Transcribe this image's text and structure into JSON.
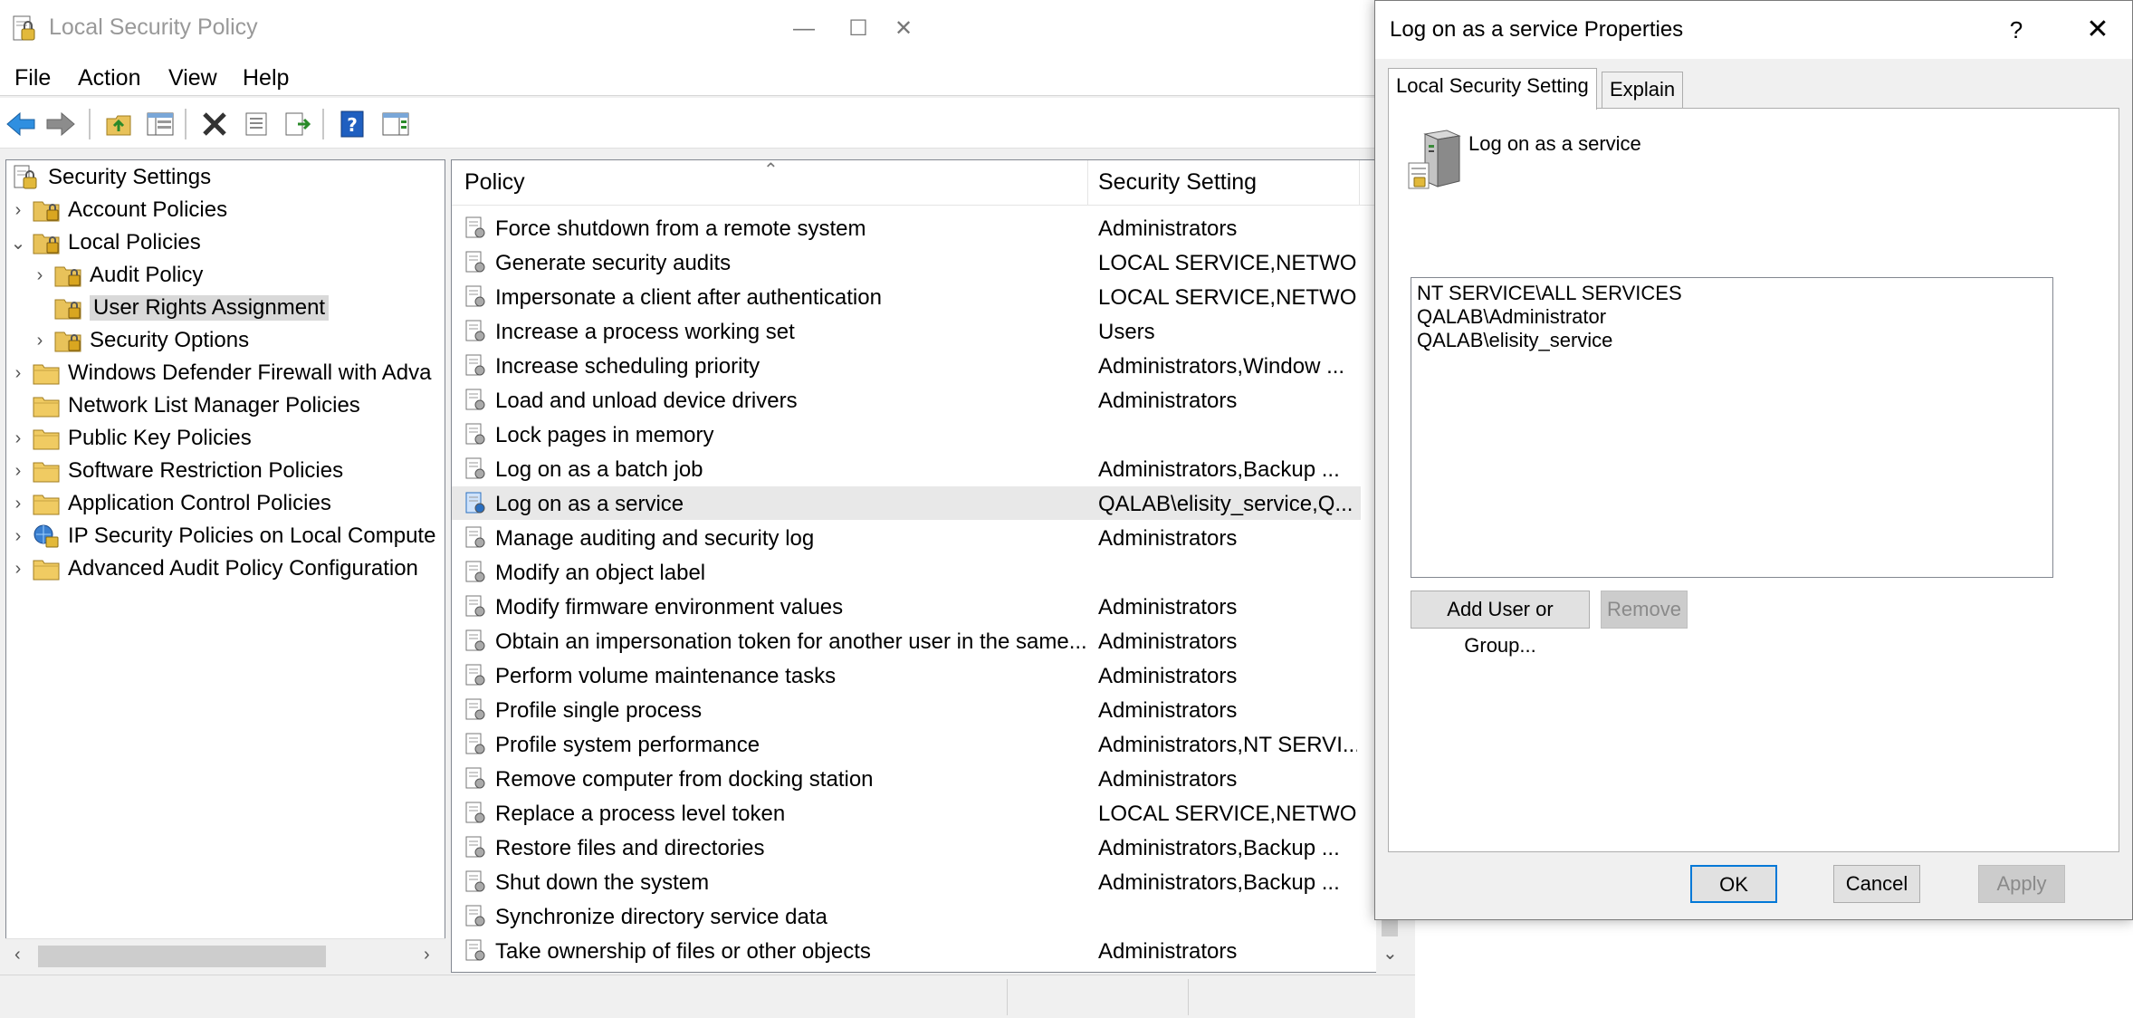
{
  "main_window": {
    "title": "Local Security Policy",
    "controls": {
      "minimize": "—",
      "maximize": "☐",
      "close": "✕"
    }
  },
  "menu": [
    "File",
    "Action",
    "View",
    "Help"
  ],
  "toolbar": {
    "icons": [
      "back-arrow-icon",
      "forward-arrow-icon",
      "up-folder-icon",
      "show-hide-tree-icon",
      "delete-icon",
      "properties-icon",
      "export-list-icon",
      "help-icon",
      "action-pane-icon"
    ]
  },
  "tree": [
    {
      "label": "Security Settings",
      "level": 0,
      "expander": "",
      "icon": "security-settings-icon"
    },
    {
      "label": "Account Policies",
      "level": 1,
      "expander": "›",
      "icon": "locked-folder-icon"
    },
    {
      "label": "Local Policies",
      "level": 1,
      "expander": "⌄",
      "icon": "locked-folder-icon"
    },
    {
      "label": "Audit Policy",
      "level": 2,
      "expander": "›",
      "icon": "locked-folder-icon"
    },
    {
      "label": "User Rights Assignment",
      "level": 2,
      "expander": "",
      "icon": "locked-folder-icon",
      "selected": true
    },
    {
      "label": "Security Options",
      "level": 2,
      "expander": "›",
      "icon": "locked-folder-icon"
    },
    {
      "label": "Windows Defender Firewall with Adva",
      "level": 1,
      "expander": "›",
      "icon": "folder-icon"
    },
    {
      "label": "Network List Manager Policies",
      "level": 1,
      "expander": "",
      "icon": "folder-icon"
    },
    {
      "label": "Public Key Policies",
      "level": 1,
      "expander": "›",
      "icon": "folder-icon"
    },
    {
      "label": "Software Restriction Policies",
      "level": 1,
      "expander": "›",
      "icon": "folder-icon"
    },
    {
      "label": "Application Control Policies",
      "level": 1,
      "expander": "›",
      "icon": "folder-icon"
    },
    {
      "label": "IP Security Policies on Local Compute",
      "level": 1,
      "expander": "›",
      "icon": "ip-security-icon"
    },
    {
      "label": "Advanced Audit Policy Configuration",
      "level": 1,
      "expander": "›",
      "icon": "folder-icon"
    }
  ],
  "list": {
    "columns": {
      "policy": "Policy",
      "setting": "Security Setting"
    },
    "rows": [
      {
        "policy": "Force shutdown from a remote system",
        "setting": "Administrators"
      },
      {
        "policy": "Generate security audits",
        "setting": "LOCAL SERVICE,NETWO..."
      },
      {
        "policy": "Impersonate a client after authentication",
        "setting": "LOCAL SERVICE,NETWO..."
      },
      {
        "policy": "Increase a process working set",
        "setting": "Users"
      },
      {
        "policy": "Increase scheduling priority",
        "setting": "Administrators,Window ..."
      },
      {
        "policy": "Load and unload device drivers",
        "setting": "Administrators"
      },
      {
        "policy": "Lock pages in memory",
        "setting": ""
      },
      {
        "policy": "Log on as a batch job",
        "setting": "Administrators,Backup ..."
      },
      {
        "policy": "Log on as a service",
        "setting": "QALAB\\elisity_service,Q...",
        "selected": true
      },
      {
        "policy": "Manage auditing and security log",
        "setting": "Administrators"
      },
      {
        "policy": "Modify an object label",
        "setting": ""
      },
      {
        "policy": "Modify firmware environment values",
        "setting": "Administrators"
      },
      {
        "policy": "Obtain an impersonation token for another user in the same...",
        "setting": "Administrators"
      },
      {
        "policy": "Perform volume maintenance tasks",
        "setting": "Administrators"
      },
      {
        "policy": "Profile single process",
        "setting": "Administrators"
      },
      {
        "policy": "Profile system performance",
        "setting": "Administrators,NT SERVI..."
      },
      {
        "policy": "Remove computer from docking station",
        "setting": "Administrators"
      },
      {
        "policy": "Replace a process level token",
        "setting": "LOCAL SERVICE,NETWO..."
      },
      {
        "policy": "Restore files and directories",
        "setting": "Administrators,Backup ..."
      },
      {
        "policy": "Shut down the system",
        "setting": "Administrators,Backup ..."
      },
      {
        "policy": "Synchronize directory service data",
        "setting": ""
      },
      {
        "policy": "Take ownership of files or other objects",
        "setting": "Administrators"
      }
    ]
  },
  "dialog": {
    "title": "Log on as a service Properties",
    "help": "?",
    "close": "✕",
    "tabs": [
      "Local Security Setting",
      "Explain"
    ],
    "policy_name": "Log on as a service",
    "members": [
      "NT SERVICE\\ALL SERVICES",
      "QALAB\\Administrator",
      "QALAB\\elisity_service"
    ],
    "add_button": "Add User or Group...",
    "remove_button": "Remove",
    "ok_button": "OK",
    "cancel_button": "Cancel",
    "apply_button": "Apply"
  },
  "colors": {
    "accent": "#0078d7",
    "selected_row": "#e8e8e8",
    "folder": "#e8c25a"
  }
}
